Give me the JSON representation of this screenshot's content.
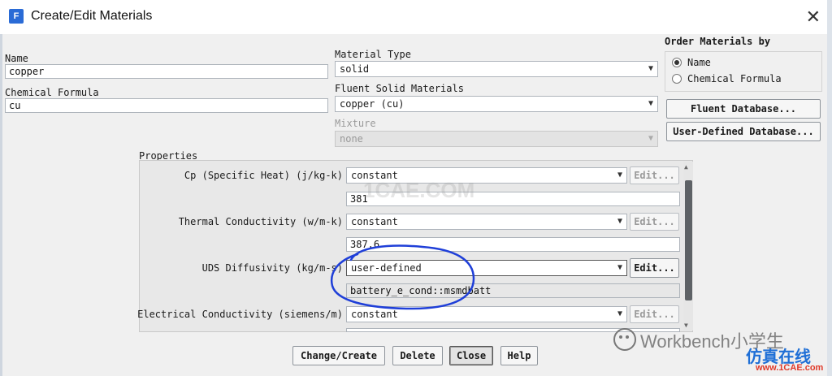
{
  "window": {
    "title": "Create/Edit Materials",
    "icon_letter": "F"
  },
  "name": {
    "label": "Name",
    "value": "copper"
  },
  "chemical_formula": {
    "label": "Chemical Formula",
    "value": "cu"
  },
  "material_type": {
    "label": "Material Type",
    "value": "solid"
  },
  "fluent_solid_materials": {
    "label": "Fluent Solid Materials",
    "value": "copper (cu)"
  },
  "mixture": {
    "label": "Mixture",
    "value": "none"
  },
  "order": {
    "title": "Order Materials by",
    "options": [
      {
        "label": "Name",
        "selected": true
      },
      {
        "label": "Chemical Formula",
        "selected": false
      }
    ]
  },
  "database_buttons": {
    "fluent": "Fluent Database...",
    "user_defined": "User-Defined Database..."
  },
  "properties": {
    "title": "Properties",
    "edit_label": "Edit...",
    "rows": [
      {
        "label": "Cp (Specific Heat) (j/kg-k)",
        "method": "constant",
        "value": "381"
      },
      {
        "label": "Thermal Conductivity (w/m-k)",
        "method": "constant",
        "value": "387.6"
      },
      {
        "label": "UDS Diffusivity (kg/m-s)",
        "method": "user-defined",
        "value": "battery_e_cond::msmdbatt"
      },
      {
        "label": "Electrical Conductivity (siemens/m)",
        "method": "constant",
        "value": ""
      }
    ]
  },
  "footer_buttons": {
    "change_create": "Change/Create",
    "delete": "Delete",
    "close": "Close",
    "help": "Help"
  },
  "watermarks": {
    "center": "1CAE.COM",
    "wechat": "Workbench小学生",
    "site_cn": "仿真在线",
    "site": "www.1CAE.com"
  },
  "colors": {
    "annotation_ink": "#1f3fd8",
    "titlebar": "#ffffff",
    "dialog_bg": "#f0f0f0"
  }
}
